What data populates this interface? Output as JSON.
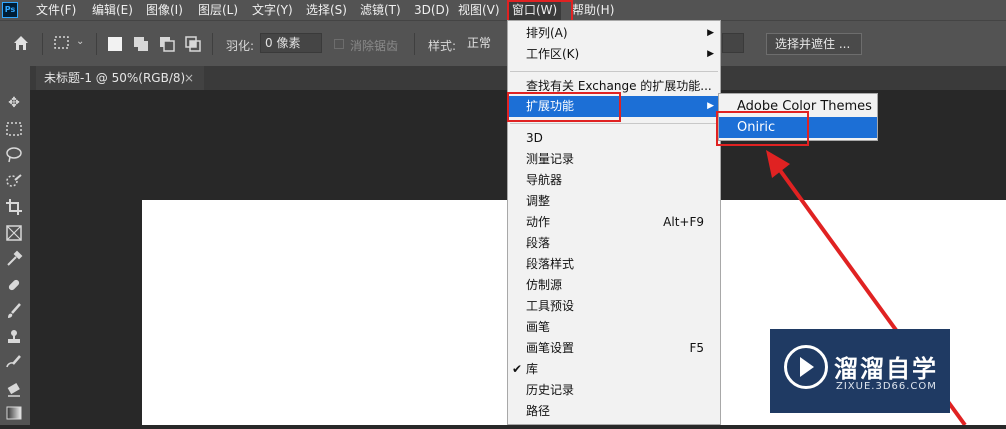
{
  "app": {
    "logo_text": "Ps"
  },
  "menubar": {
    "items": [
      "文件(F)",
      "编辑(E)",
      "图像(I)",
      "图层(L)",
      "文字(Y)",
      "选择(S)",
      "滤镜(T)",
      "3D(D)",
      "视图(V)",
      "窗口(W)",
      "帮助(H)"
    ],
    "active_item": "窗口(W)"
  },
  "options": {
    "feather_label": "羽化:",
    "feather_value": "0 像素",
    "antialias_label": "消除锯齿",
    "style_label": "样式:",
    "style_value": "正常",
    "select_mask_button": "选择并遮住 ..."
  },
  "document_tab": {
    "title": "未标题-1 @ 50%(RGB/8)",
    "close_symbol": "×"
  },
  "window_menu": {
    "items": [
      {
        "label": "排列(A)",
        "submenu": true
      },
      {
        "label": "工作区(K)",
        "submenu": true
      },
      {
        "label": "查找有关 Exchange 的扩展功能..."
      },
      {
        "label": "扩展功能",
        "submenu": true,
        "highlighted": true
      },
      {
        "label": "3D"
      },
      {
        "label": "测量记录"
      },
      {
        "label": "导航器"
      },
      {
        "label": "调整"
      },
      {
        "label": "动作",
        "shortcut": "Alt+F9"
      },
      {
        "label": "段落"
      },
      {
        "label": "段落样式"
      },
      {
        "label": "仿制源"
      },
      {
        "label": "工具预设"
      },
      {
        "label": "画笔"
      },
      {
        "label": "画笔设置",
        "shortcut": "F5"
      },
      {
        "label": "库",
        "checked": true
      },
      {
        "label": "历史记录"
      },
      {
        "label": "路径"
      }
    ]
  },
  "extensions_submenu": {
    "items": [
      {
        "label": "Adobe Color Themes"
      },
      {
        "label": "Oniric",
        "highlighted": true
      }
    ]
  },
  "watermark": {
    "title": "溜溜自学",
    "subtitle": "ZIXUE.3D66.COM"
  },
  "colors": {
    "highlight": "#1c6fd6",
    "annotation_red": "#e02222",
    "menubar_bg": "#535353",
    "canvas_bg": "#282828"
  }
}
